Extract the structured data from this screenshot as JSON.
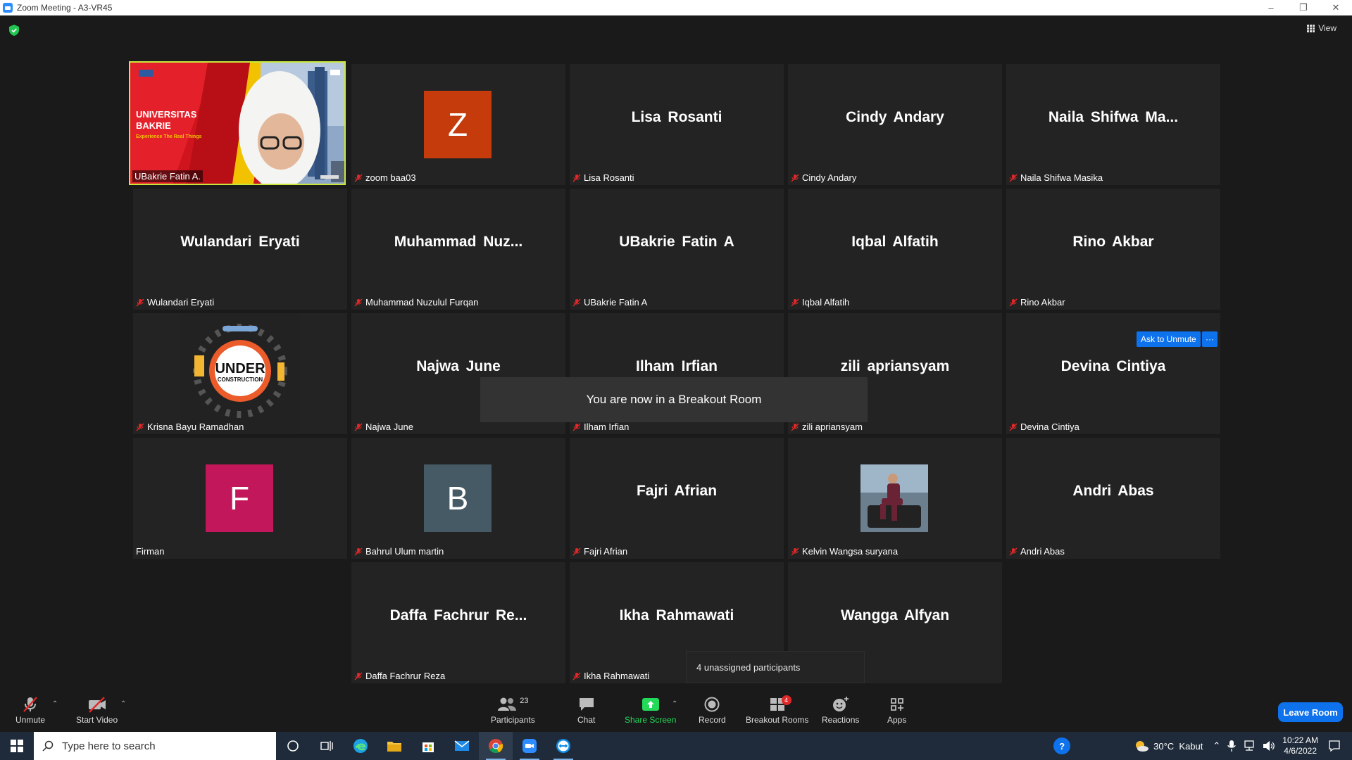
{
  "window": {
    "title": "Zoom Meeting - A3-VR45",
    "minimize": "–",
    "restore": "❐",
    "close": "✕"
  },
  "meeting": {
    "view_label": "View",
    "active_speaker": {
      "name": "UBakrie Fatin A.",
      "slide_title": "UNIVERSITAS BAKRIE",
      "slide_tagline": "Experience The Real Things"
    },
    "tiles": [
      {
        "id": "t2",
        "big": "",
        "avatar_letter": "Z",
        "avatar_color": "#c63b0b",
        "label": "zoom baa03",
        "muted": true
      },
      {
        "id": "t3",
        "big": "Lisa Rosanti",
        "label": "Lisa Rosanti",
        "muted": true
      },
      {
        "id": "t4",
        "big": "Cindy Andary",
        "label": "Cindy Andary",
        "muted": true
      },
      {
        "id": "t5",
        "big": "Naila Shifwa Ma...",
        "label": "Naila Shifwa Masika",
        "muted": true
      },
      {
        "id": "t6",
        "big": "Wulandari Eryati",
        "label": "Wulandari Eryati",
        "muted": true
      },
      {
        "id": "t7",
        "big": "Muhammad Nuz...",
        "label": "Muhammad Nuzulul Furqan",
        "muted": true
      },
      {
        "id": "t8",
        "big": "UBakrie Fatin A",
        "label": "UBakrie Fatin A",
        "muted": true
      },
      {
        "id": "t9",
        "big": "Iqbal Alfatih",
        "label": "Iqbal Alfatih",
        "muted": true
      },
      {
        "id": "t10",
        "big": "Rino Akbar",
        "label": "Rino Akbar",
        "muted": true
      },
      {
        "id": "t11",
        "big": "",
        "under_construction": true,
        "label": "Krisna Bayu Ramadhan",
        "muted": true
      },
      {
        "id": "t12",
        "big": "Najwa June",
        "label": "Najwa June",
        "muted": true
      },
      {
        "id": "t13",
        "big": "Ilham Irfian",
        "label": "Ilham Irfian",
        "muted": true
      },
      {
        "id": "t14",
        "big": "zili apriansyam",
        "label": "zili apriansyam",
        "muted": true
      },
      {
        "id": "t15",
        "big": "Devina Cintiya",
        "label": "Devina Cintiya",
        "muted": true
      },
      {
        "id": "t16",
        "big": "",
        "avatar_letter": "F",
        "avatar_color": "#c2185b",
        "label": "Firman",
        "muted": false
      },
      {
        "id": "t17",
        "big": "",
        "avatar_letter": "B",
        "avatar_color": "#455a64",
        "label": "Bahrul Ulum martin",
        "muted": true
      },
      {
        "id": "t18",
        "big": "Fajri Afrian",
        "label": "Fajri Afrian",
        "muted": true
      },
      {
        "id": "t19",
        "big": "",
        "photo": true,
        "label": "Kelvin Wangsa suryana",
        "muted": true
      },
      {
        "id": "t20",
        "big": "Andri Abas",
        "label": "Andri Abas",
        "muted": true
      },
      {
        "id": "t21",
        "big": "Daffa Fachrur Re...",
        "label": "Daffa Fachrur Reza",
        "muted": true
      },
      {
        "id": "t22",
        "big": "Ikha Rahmawati",
        "label": "Ikha Rahmawati",
        "muted": true
      },
      {
        "id": "t23",
        "big": "Wangga Alfyan",
        "label": "",
        "muted": false
      }
    ],
    "under_construction_text": {
      "line1": "UNDER",
      "line2": "CONSTRUCTION"
    },
    "breakout_toast": "You are now in a Breakout Room",
    "ask_to_unmute": "Ask to Unmute",
    "more_label": "···",
    "unassigned_popup": "4 unassigned participants"
  },
  "toolbar": {
    "unmute": "Unmute",
    "start_video": "Start Video",
    "participants": "Participants",
    "participants_count": "23",
    "chat": "Chat",
    "share_screen": "Share Screen",
    "record": "Record",
    "breakout_rooms": "Breakout Rooms",
    "breakout_badge": "4",
    "reactions": "Reactions",
    "apps": "Apps",
    "leave": "Leave Room",
    "caret": "⌃"
  },
  "taskbar": {
    "search_placeholder": "Type here to search",
    "weather": "30°C  Kabut",
    "time": "10:22 AM",
    "date": "4/6/2022"
  },
  "colors": {
    "accent": "#0e72ed",
    "active_speaker_border": "#c9e63a",
    "share_green": "#23d959",
    "muted_red": "#e02828"
  }
}
